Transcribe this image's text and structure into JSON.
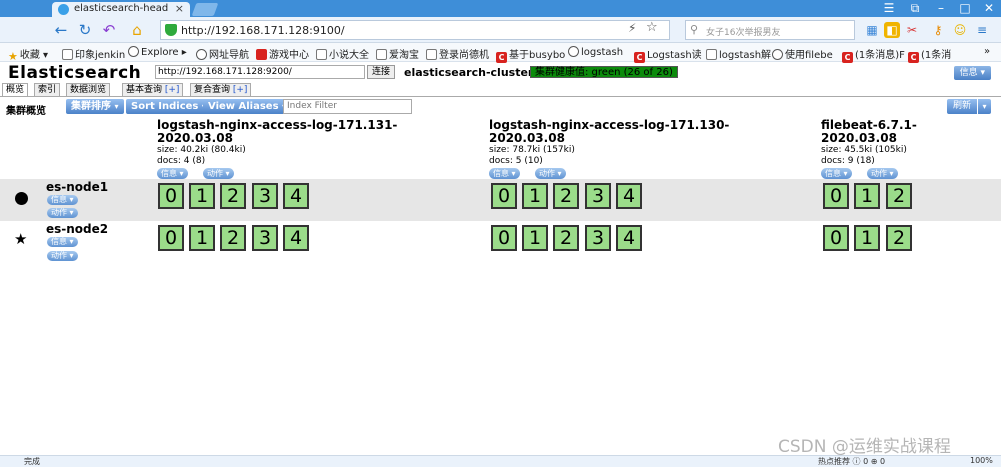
{
  "browser": {
    "tab_title": "elasticsearch-head",
    "tab_close": "×",
    "address": "http://192.168.171.128:9100/",
    "search_placeholder": "女子16次举报男友",
    "window_controls": [
      "☰",
      "⧉",
      "–",
      "□",
      "✕"
    ],
    "nav_icons": [
      "back-icon",
      "refresh-icon",
      "undo-icon",
      "home-icon"
    ],
    "more": "»"
  },
  "bookmarks": [
    {
      "label": "收藏",
      "icon": "star-icon"
    },
    {
      "label": "印象jenkin",
      "icon": "doc-icon"
    },
    {
      "label": "Explore",
      "icon": "globe-icon"
    },
    {
      "label": "网址导航",
      "icon": "globe-icon"
    },
    {
      "label": "游戏中心",
      "icon": "game-icon"
    },
    {
      "label": "小说大全",
      "icon": "doc-icon"
    },
    {
      "label": "爱淘宝",
      "icon": "doc-icon"
    },
    {
      "label": "登录尚德机",
      "icon": "doc-icon"
    },
    {
      "label": "基于busybo",
      "icon": "csdn-icon"
    },
    {
      "label": "logstash",
      "icon": "globe-icon"
    },
    {
      "label": "Logstash读",
      "icon": "csdn-icon"
    },
    {
      "label": "logstash解",
      "icon": "doc-icon"
    },
    {
      "label": "使用filebe",
      "icon": "globe-icon"
    },
    {
      "label": "(1条消息)F",
      "icon": "csdn-icon"
    },
    {
      "label": "(1条消",
      "icon": "csdn-icon"
    }
  ],
  "es": {
    "title": "Elasticsearch",
    "url": "http://192.168.171.128:9200/",
    "connect_label": "连接",
    "cluster_name": "elasticsearch-cluster",
    "cluster_health": "集群健康值: green (26 of 26)",
    "info_label": "信息 ▾",
    "tabs": [
      {
        "label": "概览",
        "plus": ""
      },
      {
        "label": "索引",
        "plus": ""
      },
      {
        "label": "数据浏览",
        "plus": ""
      },
      {
        "label": "基本查询 ",
        "plus": "[+]"
      },
      {
        "label": "复合查询 ",
        "plus": "[+]"
      }
    ],
    "toolbar": {
      "overview_label": "集群概览",
      "sort_cluster": "集群排序",
      "sort_indices": "Sort Indices",
      "view_aliases": "View Aliases",
      "index_filter_placeholder": "Index Filter",
      "refresh": "刷新",
      "caret": "▾"
    },
    "indices": [
      {
        "name_line1": "logstash-nginx-access-log-171.131-",
        "name_line2": "2020.03.08",
        "size": "size: 40.2ki (80.4ki)",
        "docs": "docs: 4 (8)",
        "info": "信息",
        "action": "动作"
      },
      {
        "name_line1": "logstash-nginx-access-log-171.130-",
        "name_line2": "2020.03.08",
        "size": "size: 78.7ki (157ki)",
        "docs": "docs: 5 (10)",
        "info": "信息",
        "action": "动作"
      },
      {
        "name_line1": "filebeat-6.7.1-",
        "name_line2": "2020.03.08",
        "size": "size: 45.5ki (105ki)",
        "docs": "docs: 9 (18)",
        "info": "信息",
        "action": "动作"
      }
    ],
    "nodes": [
      {
        "name": "es-node1",
        "marker": "●",
        "info": "信息",
        "action": "动作"
      },
      {
        "name": "es-node2",
        "marker": "★",
        "info": "信息",
        "action": "动作"
      }
    ],
    "shards": {
      "index_0": [
        "0",
        "1",
        "2",
        "3",
        "4"
      ],
      "index_1": [
        "0",
        "1",
        "2",
        "3",
        "4"
      ],
      "index_2": [
        "0",
        "1",
        "2"
      ]
    },
    "colors": {
      "shard_fill": "#9bdc8a",
      "health_green": "#0b8a0b",
      "button_blue": "#4b82c8"
    }
  },
  "status": {
    "left": "完成",
    "right": "热点推荐   ⓘ 0   ⊕ 0   ",
    "zoom": "100%"
  },
  "watermark": "CSDN @运维实战课程"
}
